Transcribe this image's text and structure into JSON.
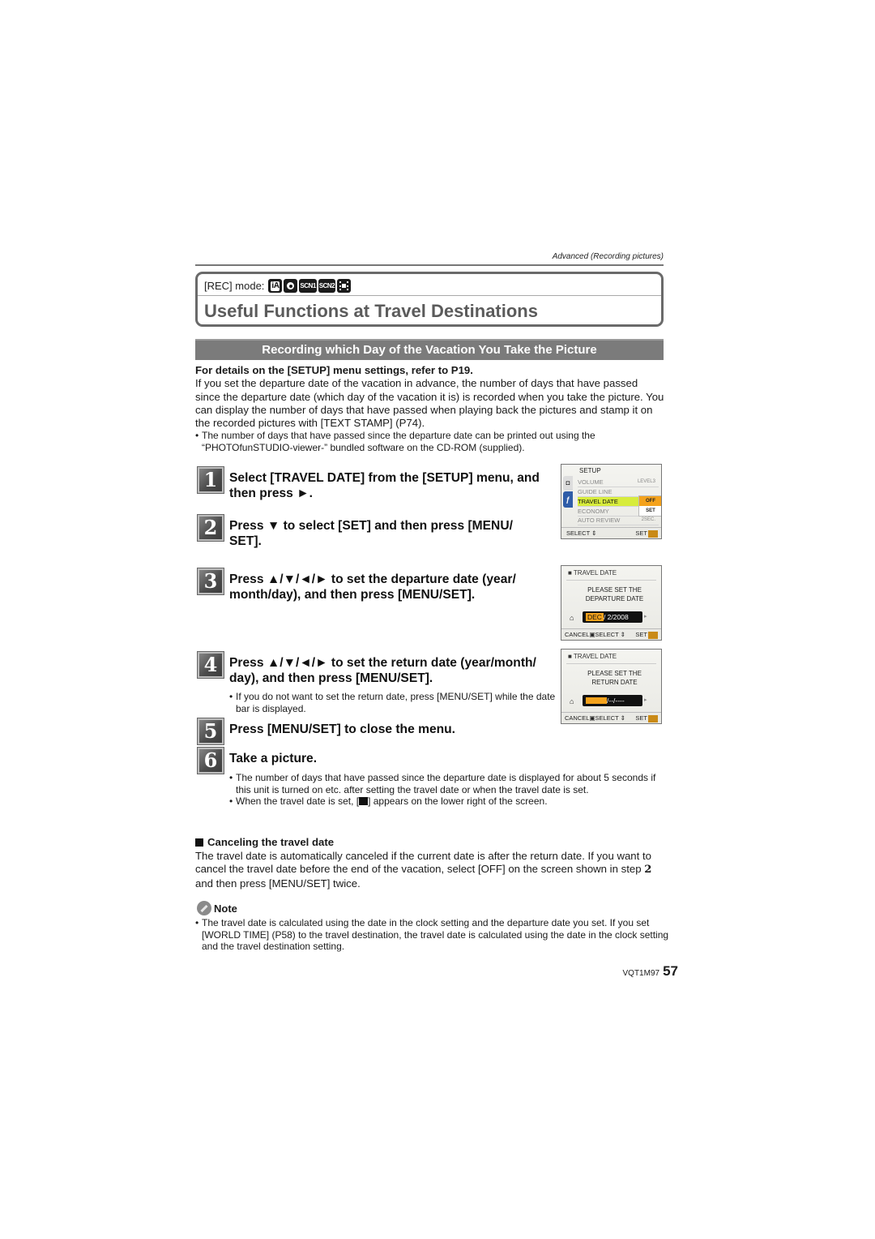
{
  "header": {
    "section_caption": "Advanced (Recording pictures)"
  },
  "title_box": {
    "rec_mode_label": "[REC] mode:",
    "mode_icons": [
      "iA",
      "normal-picture",
      "SCN1",
      "SCN2",
      "motion-picture"
    ],
    "title": "Useful Functions at Travel Destinations"
  },
  "section": {
    "title": "Recording which Day of the Vacation You Take the Picture"
  },
  "intro": {
    "lead": "For details on the [SETUP] menu settings, refer to P19.",
    "body": "If you set the departure date of the vacation in advance, the number of days that have passed since the departure date (which day of the vacation it is) is recorded when you take the picture. You can display the number of days that have passed when playing back the pictures and stamp it on the recorded pictures with [TEXT STAMP] (P74).",
    "bullet": "The number of days that have passed since the departure date can be printed out using the “PHOTOfunSTUDIO-viewer-” bundled software on the CD-ROM (supplied)."
  },
  "steps": [
    {
      "num": "1",
      "text": "Select [TRAVEL DATE] from the [SETUP] menu, and then press ►."
    },
    {
      "num": "2",
      "text": "Press ▼ to select [SET] and then press [MENU/ SET]."
    },
    {
      "num": "3",
      "text": "Press ▲/▼/◄/► to set the departure date (year/ month/day), and then press [MENU/SET]."
    },
    {
      "num": "4",
      "text": "Press ▲/▼/◄/► to set the return date (year/month/ day), and then press [MENU/SET].",
      "note": "If you do not want to set the return date, press [MENU/SET] while the date bar is displayed."
    },
    {
      "num": "5",
      "text": "Press [MENU/SET] to close the menu."
    },
    {
      "num": "6",
      "text": "Take a picture.",
      "notes": [
        "The number of days that have passed since the departure date is displayed for about 5 seconds if this unit is turned on etc. after setting the travel date or when the travel date is set.",
        "When the travel date is set, [",
        "] appears on the lower right of the screen."
      ]
    }
  ],
  "screens": {
    "setup": {
      "title": "SETUP",
      "rows": [
        {
          "label": "VOLUME",
          "value": "LEVEL3"
        },
        {
          "label": "GUIDE LINE",
          "value": ""
        },
        {
          "label": "TRAVEL DATE",
          "value": ""
        },
        {
          "label": "ECONOMY",
          "value": ""
        },
        {
          "label": "AUTO REVIEW",
          "value": "2SEC."
        }
      ],
      "popup_options": [
        "OFF",
        "SET"
      ],
      "selected_option": "OFF",
      "footer_left": "SELECT",
      "footer_right": "SET"
    },
    "departure": {
      "title": "TRAVEL DATE",
      "message_line1": "PLEASE SET THE",
      "message_line2": "DEPARTURE DATE",
      "date_month": "DEC",
      "date_rest": "/  2/2008",
      "footer_cancel": "CANCEL",
      "footer_select": "SELECT",
      "footer_set": "SET"
    },
    "return": {
      "title": "TRAVEL DATE",
      "message_line1": "PLEASE SET THE",
      "message_line2": "RETURN DATE",
      "date_rest": "/--/----",
      "footer_cancel": "CANCEL",
      "footer_select": "SELECT",
      "footer_set": "SET"
    }
  },
  "canceling": {
    "heading": "Canceling the travel date",
    "body_before": "The travel date is automatically canceled if the current date is after the return date. If you want to cancel the travel date before the end of the vacation, select [OFF] on the screen shown in step ",
    "step_ref": "2",
    "body_after": " and then press [MENU/SET] twice."
  },
  "note": {
    "heading": "Note",
    "bullet": "The travel date is calculated using the date in the clock setting and the departure date you set. If you set [WORLD TIME] (P58) to the travel destination, the travel date is calculated using the date in the clock setting and the travel destination setting."
  },
  "footer": {
    "model_code": "VQT1M97",
    "page_number": "57"
  }
}
